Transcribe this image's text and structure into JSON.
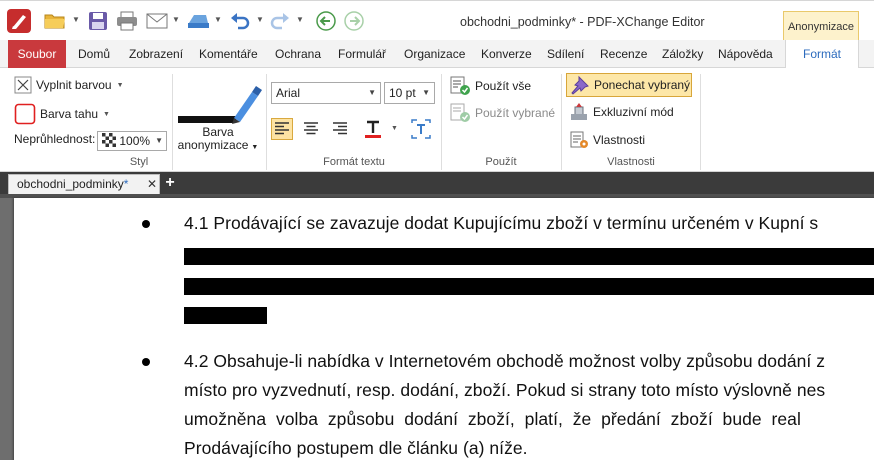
{
  "titlebar": {
    "document_title": "obchodni_podminky* - PDF-XChange Editor",
    "context_tab": "Anonymizace"
  },
  "ribbon_tabs": [
    "Soubor",
    "Domů",
    "Zobrazení",
    "Komentáře",
    "Ochrana",
    "Formulář",
    "Organizace",
    "Konverze",
    "Sdílení",
    "Recenze",
    "Záložky",
    "Nápověda",
    "Formát"
  ],
  "ribbon": {
    "style": {
      "fill_color": "Vyplnit barvou",
      "stroke_color": "Barva tahu",
      "opacity_label": "Neprůhlednost:",
      "opacity_value": "100%",
      "redaction_color_line1": "Barva",
      "redaction_color_line2": "anonymizace",
      "group": "Styl"
    },
    "text_format": {
      "font": "Arial",
      "size": "10 pt",
      "group": "Formát textu"
    },
    "apply": {
      "apply_all": "Použít vše",
      "apply_selected": "Použít vybrané",
      "group": "Použít"
    },
    "properties": {
      "keep_selected": "Ponechat vybraný",
      "exclusive_mode": "Exkluzivní mód",
      "properties": "Vlastnosti",
      "group": "Vlastnosti"
    }
  },
  "doc_tab": {
    "name": "obchodni_podminky",
    "modified_marker": "*"
  },
  "document": {
    "para1_line1": "4.1 Prodávající se zavazuje dodat Kupujícímu zboží v termínu určeném v Kupní s",
    "para2_line1": "4.2 Obsahuje-li nabídka v Internetovém obchodě možnost volby způsobu dodání z",
    "para2_line2": "místo pro vyzvednutí, resp. dodání, zboží. Pokud si strany toto místo výslovně nes",
    "para2_line3": "umožněna  volba  způsobu  dodání  zboží,  platí,  že  předání  zboží  bude  real",
    "para2_line4": "Prodávajícího postupem dle článku (a) níže."
  },
  "colors": {
    "file_tab": "#c9393d",
    "active_tab_text": "#2c6bbd",
    "context_tab_bg": "#fdf2cc",
    "redaction_fill": "#000000",
    "stroke_swatch": "#e02020"
  }
}
